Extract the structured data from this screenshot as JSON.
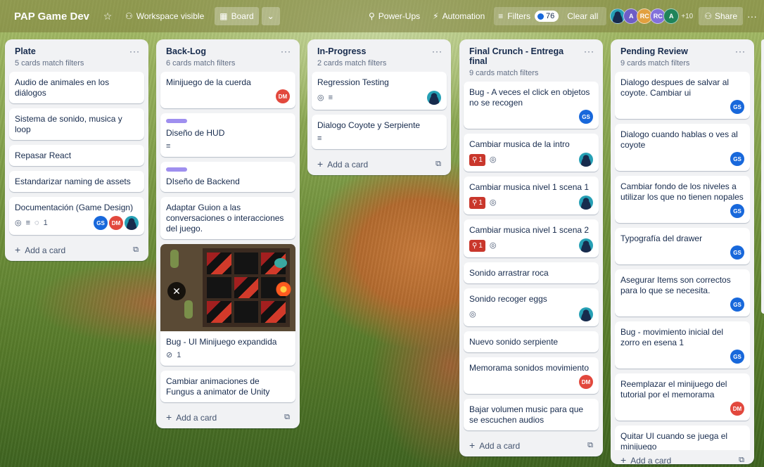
{
  "header": {
    "board_title": "PAP Game Dev",
    "visibility": "Workspace visible",
    "view_label": "Board",
    "power_ups": "Power-Ups",
    "automation": "Automation",
    "filters_label": "Filters",
    "filters_count": "76",
    "clear_all": "Clear all",
    "members": [
      {
        "initials": "",
        "color": "#26a0b5"
      },
      {
        "initials": "A",
        "color": "#6e5dc6"
      },
      {
        "initials": "RC",
        "color": "#e2a03f"
      },
      {
        "initials": "RC",
        "color": "#8270db"
      },
      {
        "initials": "A",
        "color": "#1f845a"
      }
    ],
    "more_members": "+10",
    "share": "Share"
  },
  "lists": {
    "plate": {
      "title": "Plate",
      "subtitle": "5 cards match filters",
      "cards": [
        "Audio de animales en los diálogos",
        "Sistema de sonido, musica y loop",
        "Repasar React",
        "Estandarizar naming de assets",
        "Documentación (Game Design)"
      ],
      "comment_count": "1",
      "add_card": "Add a card"
    },
    "backlog": {
      "title": "Back-Log",
      "subtitle": "6 cards match filters",
      "cards": [
        "Minijuego de la cuerda",
        "Diseño de HUD",
        "DIseño de Backend",
        "Adaptar Guion a las conversaciones o interacciones del juego.",
        "Bug - UI Minijuego expandida",
        "Cambiar animaciones de Fungus a animator de Unity"
      ],
      "attachment_count": "1",
      "add_card": "Add a card"
    },
    "inprogress": {
      "title": "In-Progress",
      "subtitle": "2 cards match filters",
      "cards": [
        "Regression Testing",
        "Dialogo Coyote y Serpiente"
      ],
      "add_card": "Add a card"
    },
    "finalcrunch": {
      "title": "Final Crunch - Entrega final",
      "subtitle": "9 cards match filters",
      "cards": [
        "Bug - A veces el click en objetos no se recogen",
        "Cambiar musica de la intro",
        "Cambiar musica nivel 1 scena 1",
        "Cambiar musica nivel 1 scena 2",
        "Sonido arrastrar roca",
        "Sonido recoger eggs",
        "Nuevo sonido serpiente",
        "Memorama sonidos movimiento",
        "Bajar volumen music para que se escuchen audios"
      ],
      "red_badge": "1",
      "add_card": "Add a card"
    },
    "pending": {
      "title": "Pending Review",
      "subtitle": "9 cards match filters",
      "cards": [
        "Dialogo despues de salvar al coyote. Cambiar ui",
        "Dialogo cuando hablas o ves al coyote",
        "Cambiar fondo de los niveles a utilizar los que no tienen nopales",
        "Typografía del drawer",
        "Asegurar Items son correctos para lo que se necesita.",
        "Bug - movimiento inicial del zorro en esena 1",
        "Reemplazar el minijuego del tutorial por el memorama",
        "Quitar UI cuando se juega el minijuego"
      ],
      "add_card": "Add a card"
    }
  },
  "avatars": {
    "gs": "GS",
    "dm": "DM"
  },
  "icons": {
    "star": "☆",
    "people": "⚇",
    "board": "▦",
    "chevron": "⌄",
    "rocket": "⚲",
    "bolt": "⚡",
    "filter": "≡",
    "share": "⚇",
    "menu": "···",
    "eye": "◎",
    "desc": "≡",
    "comment": "◌",
    "clip": "⊘",
    "plus": "+",
    "template": "⧉",
    "close": "✕"
  },
  "colors": {
    "accent": "#1868db",
    "label_purple": "#9f8fef",
    "badge_red": "#c9372c"
  }
}
